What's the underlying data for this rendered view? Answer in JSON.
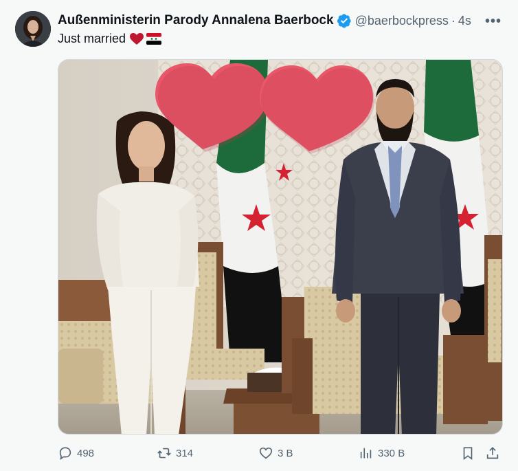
{
  "author": {
    "display_name": "Außenministerin Parody Annalena Baerbock",
    "handle": "@baerbockpress",
    "separator": "·",
    "time": "4s",
    "verified": true,
    "avatar_icon": "profile-photo"
  },
  "tweet": {
    "text": "Just married",
    "emojis": [
      "red-heart",
      "syria-flag"
    ]
  },
  "actions": {
    "replies": "498",
    "reposts": "314",
    "likes": "3 B",
    "views": "330 B"
  },
  "colors": {
    "accent": "#1d9bf0",
    "muted": "#536471",
    "heart": "#e8586a"
  },
  "icons": [
    "more-icon",
    "verified-badge-icon",
    "reply-icon",
    "repost-icon",
    "like-icon",
    "views-icon",
    "bookmark-icon",
    "share-icon"
  ]
}
